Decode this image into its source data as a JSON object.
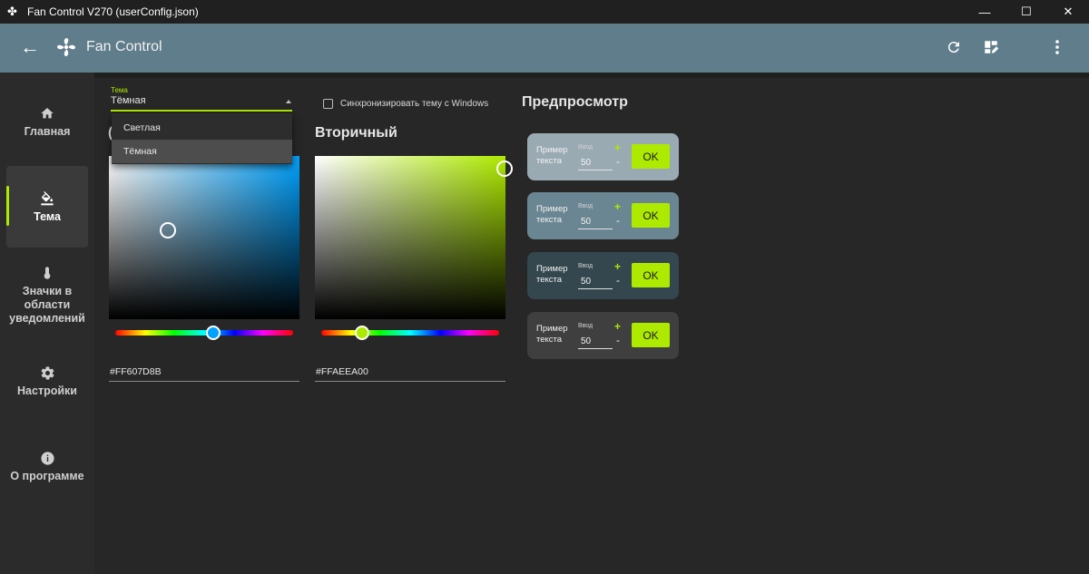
{
  "window": {
    "title": "Fan Control V270 (userConfig.json)",
    "minimize_icon": "minimize-icon",
    "maximize_icon": "maximize-icon",
    "close_icon": "close-icon"
  },
  "header": {
    "app_name": "Fan Control",
    "back_icon": "arrow-left-icon",
    "refresh_icon": "refresh-icon",
    "dashboard_icon": "dashboard-edit-icon",
    "menu_icon": "more-vertical-icon",
    "color": "#607d8b"
  },
  "sidebar": {
    "items": [
      {
        "label": "Главная",
        "icon": "home-icon"
      },
      {
        "label": "Тема",
        "icon": "paint-bucket-icon",
        "active": true
      },
      {
        "label": "Значки в области уведомлений",
        "icon": "thermometer-icon"
      },
      {
        "label": "Настройки",
        "icon": "gear-icon"
      },
      {
        "label": "О программе",
        "icon": "info-icon"
      }
    ]
  },
  "theme": {
    "label": "Тема",
    "value": "Тёмная",
    "options": [
      "Светлая",
      "Тёмная"
    ],
    "selected_option": "Тёмная",
    "sync_label": "Синхронизировать тему с Windows",
    "sync_checked": false
  },
  "secondary": {
    "heading": "Вторичный",
    "hex": "#FFAEEA00",
    "color": "#aeea00"
  },
  "primary": {
    "hex": "#FF607D8B",
    "color": "#607d8b"
  },
  "preview": {
    "title": "Предпросмотр",
    "cards": [
      {
        "label": "Пример текста",
        "input_label": "Ввод",
        "value": "50",
        "button": "OK",
        "plus": "+",
        "minus": "-"
      },
      {
        "label": "Пример текста",
        "input_label": "Ввод",
        "value": "50",
        "button": "OK",
        "plus": "+",
        "minus": "-"
      },
      {
        "label": "Пример текста",
        "input_label": "Ввод",
        "value": "50",
        "button": "OK",
        "plus": "+",
        "minus": "-"
      },
      {
        "label": "Пример текста",
        "input_label": "Ввод",
        "value": "50",
        "button": "OK",
        "plus": "+",
        "minus": "-"
      }
    ]
  },
  "colors": {
    "accent": "#aeea00",
    "background": "#272727",
    "sidebar": "#2b2b2b"
  }
}
